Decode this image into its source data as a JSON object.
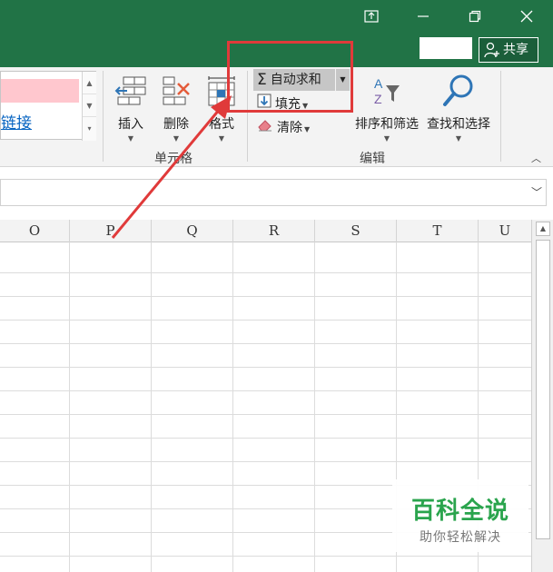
{
  "titlebar": {
    "share_label": "共享",
    "icons": [
      "ribbon-display-icon",
      "minimize-icon",
      "restore-icon",
      "close-icon",
      "person-add-icon"
    ],
    "color": "#217346"
  },
  "ribbon": {
    "style_gallery": {
      "link_text": "链接"
    },
    "cells_group": {
      "label": "单元格",
      "buttons": [
        {
          "label": "插入",
          "icon": "insert-cells-icon"
        },
        {
          "label": "删除",
          "icon": "delete-cells-icon"
        },
        {
          "label": "格式",
          "icon": "format-cells-icon"
        }
      ]
    },
    "editing_group": {
      "label": "编辑",
      "autosum_label": "自动求和",
      "autosum_symbol": "Σ",
      "fill_label": "填充",
      "clear_label": "清除",
      "sort_filter_label": "排序和筛选",
      "find_select_label": "查找和选择"
    }
  },
  "grid": {
    "columns": [
      "O",
      "P",
      "Q",
      "R",
      "S",
      "T",
      "U"
    ]
  },
  "annotation": {
    "color": "#e03a3a"
  },
  "watermark": {
    "title": "百科全说",
    "subtitle": "助你轻松解决"
  }
}
